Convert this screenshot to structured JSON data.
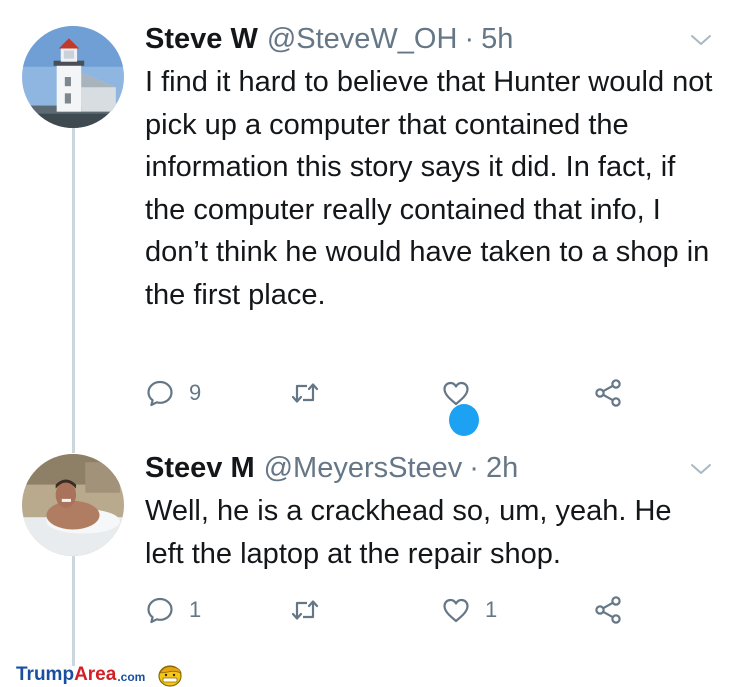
{
  "tweets": [
    {
      "name": "Steve W",
      "handle": "@SteveW_OH",
      "separator": "·",
      "time": "5h",
      "text": "I find it hard to believe that Hunter would not pick up a computer that contained the information this story says it did. In fact, if the computer really contained that info, I don’t think he would have taken to a shop in the first place.",
      "reply_count": "9",
      "retweet_count": "",
      "like_count": ""
    },
    {
      "name": "Steev M",
      "handle": "@MeyersSteev",
      "separator": "·",
      "time": "2h",
      "text": "Well, he is a crackhead so, um, yeah. He left the laptop at the repair shop.",
      "reply_count": "1",
      "retweet_count": "",
      "like_count": "1"
    }
  ],
  "watermark": {
    "part1": "Trump",
    "part2": "Area",
    "suffix": ".com"
  },
  "icons": {
    "reply": "reply-icon",
    "retweet": "retweet-icon",
    "like": "heart-icon",
    "share": "share-icon",
    "more": "chevron-down-icon"
  },
  "colors": {
    "text": "#14171a",
    "muted": "#657786",
    "thread_line": "#ccd6dd",
    "accent": "#1da1f2",
    "watermark_blue": "#1a4fa0",
    "watermark_red": "#d32027"
  }
}
